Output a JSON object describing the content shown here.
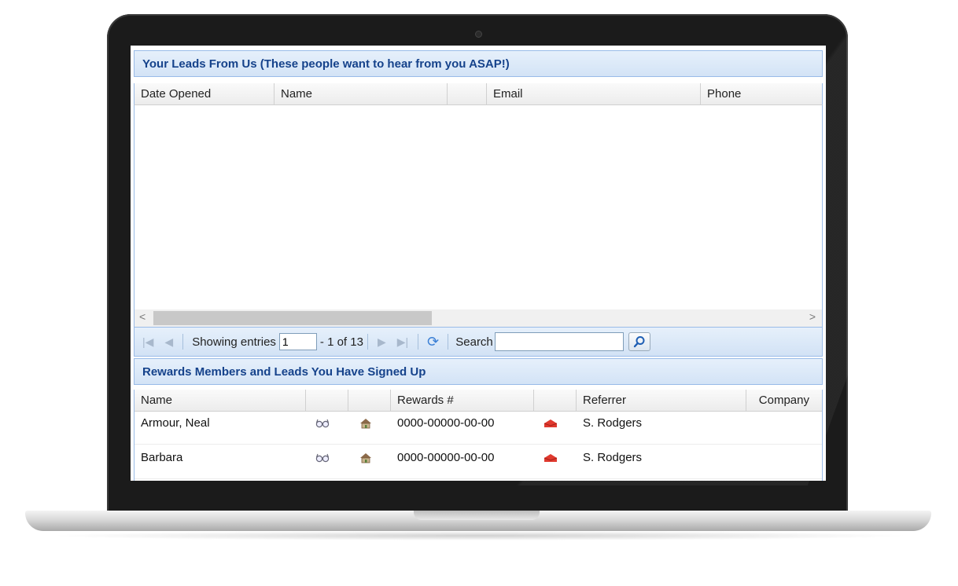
{
  "leads_panel": {
    "title": "Your Leads From Us (These people want to hear from you ASAP!)",
    "columns": [
      "Date Opened",
      "Name",
      "",
      "Email",
      "Phone"
    ]
  },
  "pager": {
    "showing_label": "Showing entries",
    "page_value": "1",
    "page_total": "- 1 of 13",
    "search_label": "Search",
    "search_value": ""
  },
  "members_panel": {
    "title": "Rewards Members and Leads You Have Signed Up",
    "columns": [
      "Name",
      "",
      "",
      "Rewards #",
      "",
      "Referrer",
      "Company"
    ],
    "rows": [
      {
        "name": "Armour, Neal",
        "rewards": "0000-00000-00-00",
        "referrer": "S. Rodgers",
        "company": ""
      },
      {
        "name": "Barbara",
        "rewards": "0000-00000-00-00",
        "referrer": "S. Rodgers",
        "company": ""
      }
    ]
  },
  "icons": {
    "view": "glasses-icon",
    "home": "house-icon",
    "contact": "red-mail-icon",
    "refresh": "refresh-icon",
    "search": "magnifier-icon"
  },
  "colors": {
    "header_text": "#15428b",
    "header_bg": "#d3e3f6",
    "border": "#99bbe8",
    "mail_icon": "#e03a2f"
  }
}
